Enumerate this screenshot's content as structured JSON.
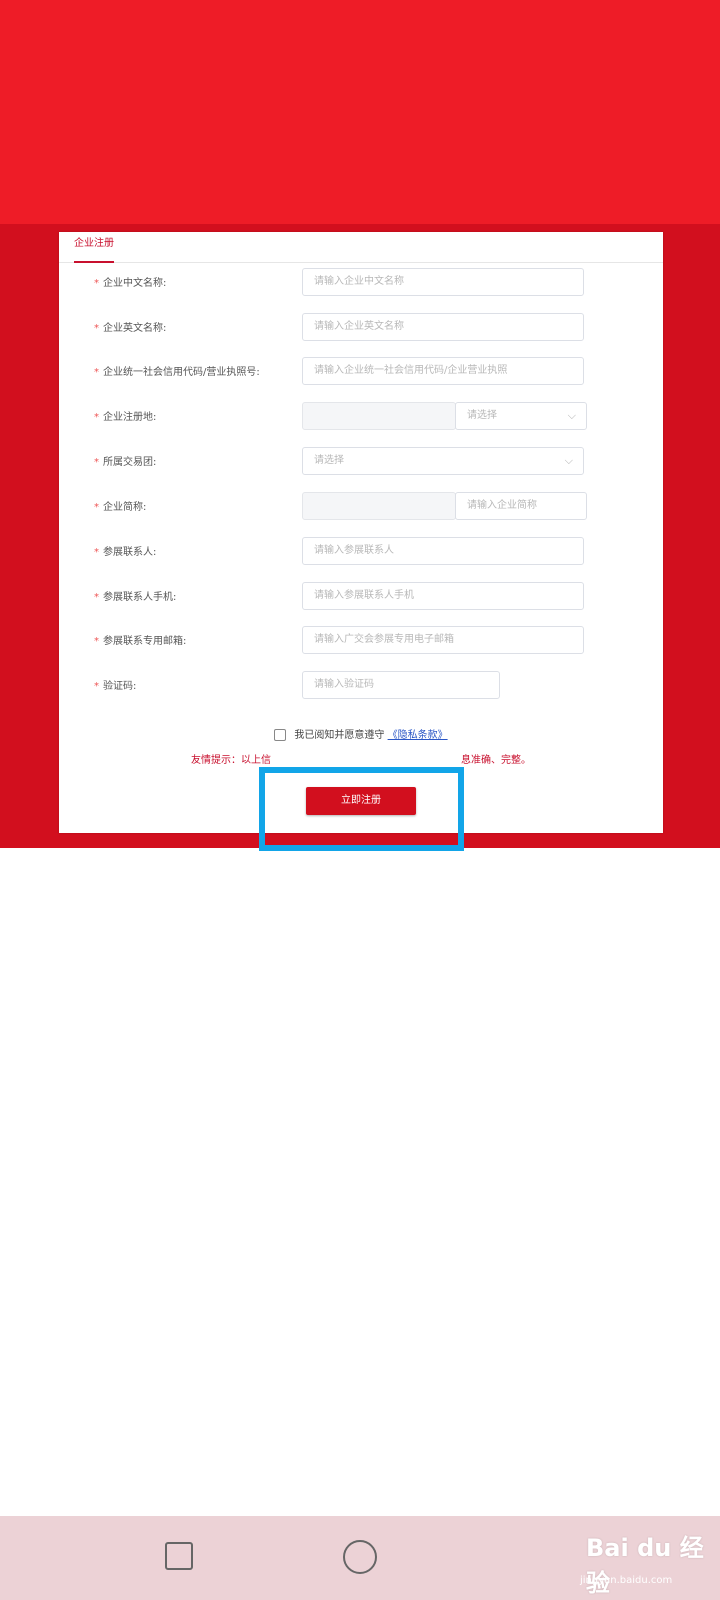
{
  "tab": {
    "label": "企业注册"
  },
  "form": {
    "rows": [
      {
        "label": "企业中文名称:",
        "placeholder": "请输入企业中文名称"
      },
      {
        "label": "企业英文名称:",
        "placeholder": "请输入企业英文名称"
      },
      {
        "label": "企业统一社会信用代码/营业执照号:",
        "placeholder": "请输入企业统一社会信用代码/企业营业执照"
      },
      {
        "label": "企业注册地:",
        "placeholder": "请选择"
      },
      {
        "label": "所属交易团:",
        "placeholder": "请选择"
      },
      {
        "label": "企业简称:",
        "placeholder": "请输入企业简称"
      },
      {
        "label": "参展联系人:",
        "placeholder": "请输入参展联系人"
      },
      {
        "label": "参展联系人手机:",
        "placeholder": "请输入参展联系人手机"
      },
      {
        "label": "参展联系专用邮箱:",
        "placeholder": "请输入广交会参展专用电子邮箱"
      },
      {
        "label": "验证码:",
        "placeholder": "请输入验证码"
      }
    ],
    "required_mark": "*"
  },
  "agreement": {
    "text": "我已阅知并愿意遵守",
    "link": "《隐私条款》"
  },
  "tip": {
    "left": "友情提示：以上信",
    "right": "息准确、完整。"
  },
  "register_button": {
    "label": "立即注册"
  },
  "watermark": {
    "brand": "Bai du 经验",
    "url": "jingyan.baidu.com"
  },
  "colors": {
    "banner": "#ee1c27",
    "band": "#d20f1e",
    "highlight": "#12a5e8",
    "link": "#2a56c6"
  }
}
